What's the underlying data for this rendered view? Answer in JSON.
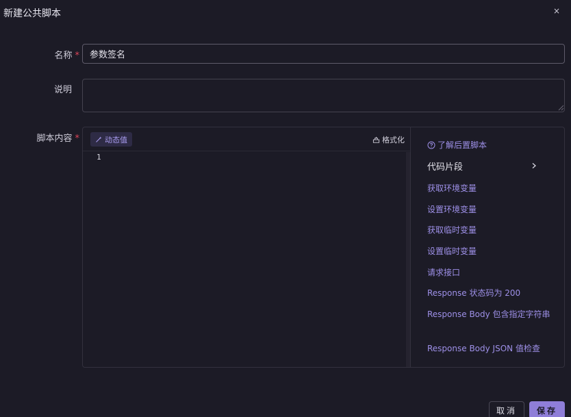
{
  "modal": {
    "title": "新建公共脚本",
    "close_label": "×"
  },
  "form": {
    "name": {
      "label": "名称",
      "required_mark": "*",
      "value": "参数签名"
    },
    "description": {
      "label": "说明",
      "value": ""
    },
    "script": {
      "label": "脚本内容",
      "required_mark": "*"
    }
  },
  "editor": {
    "dynamic_value_label": "动态值",
    "format_label": "格式化",
    "line_numbers": [
      "1"
    ]
  },
  "snippets": {
    "learn_link": "了解后置脚本",
    "title": "代码片段",
    "items": [
      "获取环境变量",
      "设置环境变量",
      "获取临时变量",
      "设置临时变量",
      "请求接口",
      "Response 状态码为 200",
      "Response Body 包含指定字符串",
      "Response Body JSON 值检查"
    ]
  },
  "footer": {
    "cancel_label": "取消",
    "save_label": "保存"
  },
  "colors": {
    "background": "#1c1b26",
    "accent": "#8f7ed8",
    "link": "#9e90e8",
    "required": "#e0455a"
  }
}
